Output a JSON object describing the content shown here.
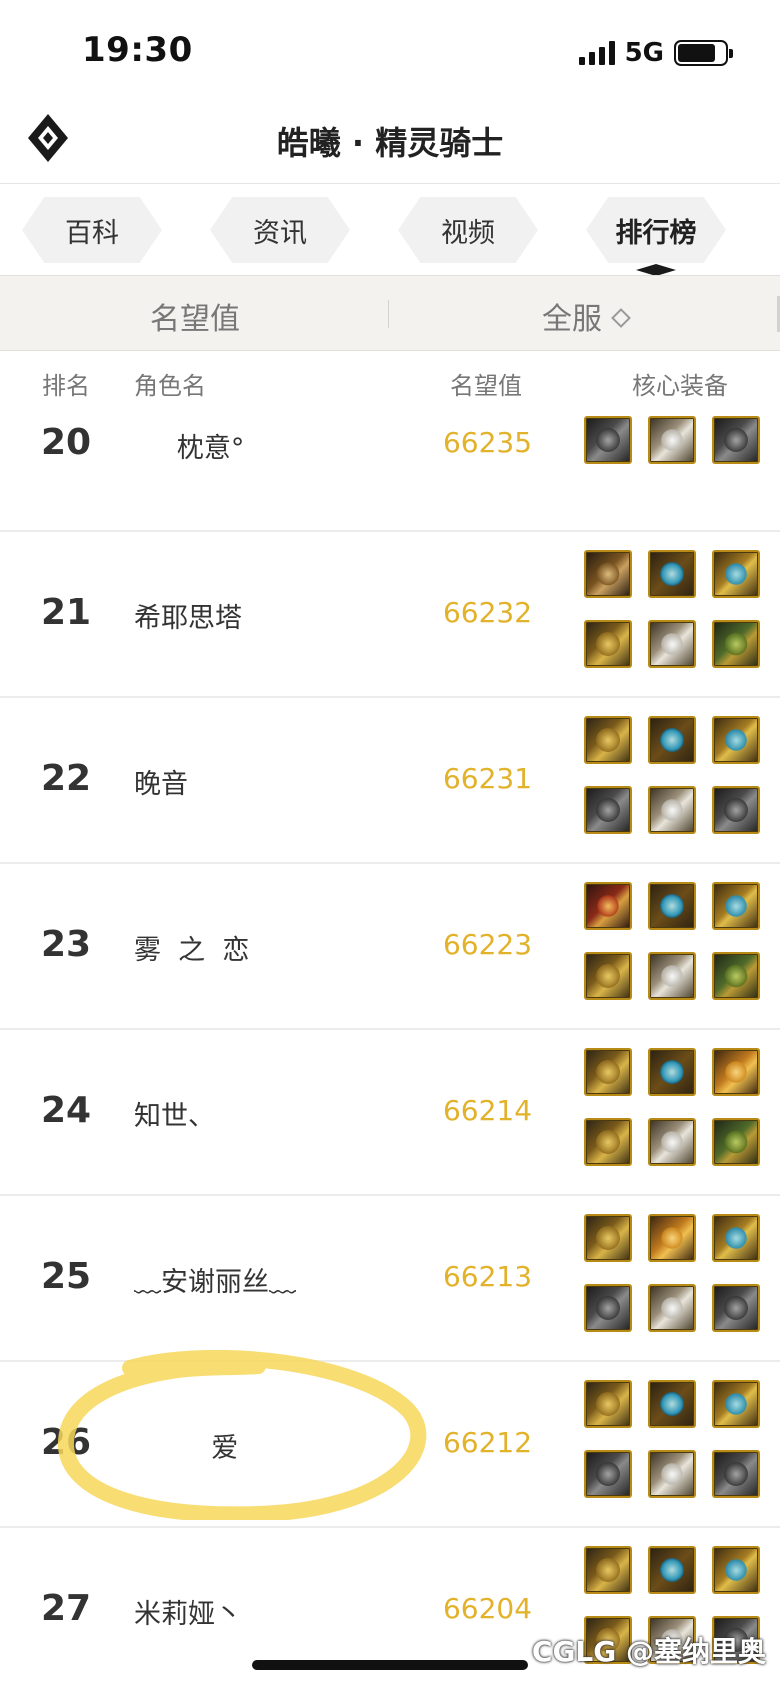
{
  "status_bar": {
    "time": "19:30",
    "network": "5G"
  },
  "header": {
    "title": "皓曦 · 精灵骑士",
    "logo_icon": "diamond-logo-icon"
  },
  "tabs": [
    {
      "label": "百科"
    },
    {
      "label": "资讯"
    },
    {
      "label": "视频"
    },
    {
      "label": "排行榜",
      "active": true
    }
  ],
  "filter": {
    "left_label": "名望值",
    "right_label": "全服"
  },
  "columns": {
    "rank": "排名",
    "name": "角色名",
    "score": "名望值",
    "equipment": "核心装备"
  },
  "accent_color": "#e2b22a",
  "rows": [
    {
      "rank": "20",
      "name": "     枕意°",
      "score": "66235",
      "equipment": [
        "eq-dark",
        "eq-white",
        "eq-dark"
      ]
    },
    {
      "rank": "21",
      "name": "希耶思塔",
      "score": "66232",
      "equipment": [
        "eq-bronze",
        "eq-cyan",
        "eq-blue-drop",
        "eq-gold",
        "eq-white",
        "eq-green"
      ]
    },
    {
      "rank": "22",
      "name": "晚音",
      "score": "66231",
      "equipment": [
        "eq-gold",
        "eq-cyan",
        "eq-blue-drop",
        "eq-dark",
        "eq-white",
        "eq-dark"
      ]
    },
    {
      "rank": "23",
      "name": "雾  之  恋",
      "score": "66223",
      "equipment": [
        "eq-red",
        "eq-cyan",
        "eq-blue-drop",
        "eq-gold",
        "eq-white",
        "eq-green"
      ]
    },
    {
      "rank": "24",
      "name": "知世、",
      "score": "66214",
      "equipment": [
        "eq-gold",
        "eq-cyan",
        "eq-orange",
        "eq-gold",
        "eq-white",
        "eq-green"
      ]
    },
    {
      "rank": "25",
      "name": "﹏安谢丽丝﹏",
      "score": "66213",
      "equipment": [
        "eq-gold",
        "eq-orange",
        "eq-blue-drop",
        "eq-dark",
        "eq-white",
        "eq-dark"
      ]
    },
    {
      "rank": "26",
      "name": "         爱",
      "score": "66212",
      "equipment": [
        "eq-gold",
        "eq-cyan",
        "eq-blue-drop",
        "eq-dark",
        "eq-white",
        "eq-dark"
      ]
    },
    {
      "rank": "27",
      "name": "米莉娅丶",
      "score": "66204",
      "equipment": [
        "eq-gold",
        "eq-cyan",
        "eq-blue-drop",
        "eq-gold",
        "eq-white",
        "eq-dark"
      ]
    }
  ],
  "watermark": "CGLG @塞纳里奥"
}
